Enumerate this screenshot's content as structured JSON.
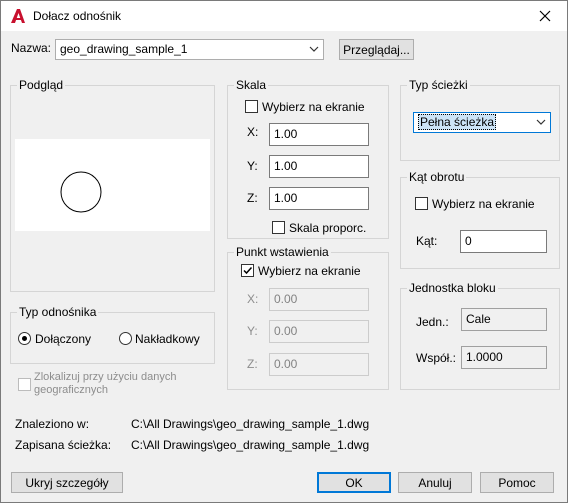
{
  "window": {
    "title": "Dołacz odnośnik",
    "close_icon": "close-icon"
  },
  "name_row": {
    "label": "Nazwa:",
    "value": "geo_drawing_sample_1",
    "browse_label": "Przeglądaj..."
  },
  "preview": {
    "title": "Podgląd"
  },
  "reference_type": {
    "title": "Typ odnośnika",
    "attached_label": "Dołączony",
    "overlay_label": "Nakładkowy",
    "selected": "attached"
  },
  "locate_geo": {
    "label_line1": "Zlokalizuj przy użyciu danych",
    "label_line2": "geograficznych"
  },
  "scale": {
    "title": "Skala",
    "specify_label": "Wybierz na ekranie",
    "x_label": "X:",
    "x_value": "1.00",
    "y_label": "Y:",
    "y_value": "1.00",
    "z_label": "Z:",
    "z_value": "1.00",
    "uniform_label": "Skala proporc."
  },
  "insertion": {
    "title": "Punkt wstawienia",
    "specify_label": "Wybierz na ekranie",
    "specify_checked": true,
    "x_label": "X:",
    "x_value": "0.00",
    "y_label": "Y:",
    "y_value": "0.00",
    "z_label": "Z:",
    "z_value": "0.00"
  },
  "path_type": {
    "title": "Typ ścieżki",
    "value": "Pełna ścieżka"
  },
  "rotation": {
    "title": "Kąt obrotu",
    "specify_label": "Wybierz na ekranie",
    "angle_label": "Kąt:",
    "angle_value": "0"
  },
  "block_unit": {
    "title": "Jednostka bloku",
    "unit_label": "Jedn.:",
    "unit_value": "Cale",
    "factor_label": "Współ.:",
    "factor_value": "1.0000"
  },
  "found_in": {
    "label": "Znaleziono w:",
    "value": "C:\\All Drawings\\geo_drawing_sample_1.dwg"
  },
  "saved_path": {
    "label": "Zapisana ścieżka:",
    "value": "C:\\All Drawings\\geo_drawing_sample_1.dwg"
  },
  "footer": {
    "hide_details": "Ukryj szczegóły",
    "ok": "OK",
    "cancel": "Anuluj",
    "help": "Pomoc"
  },
  "colors": {
    "accent": "#0078d7",
    "app_red": "#c8102e"
  }
}
